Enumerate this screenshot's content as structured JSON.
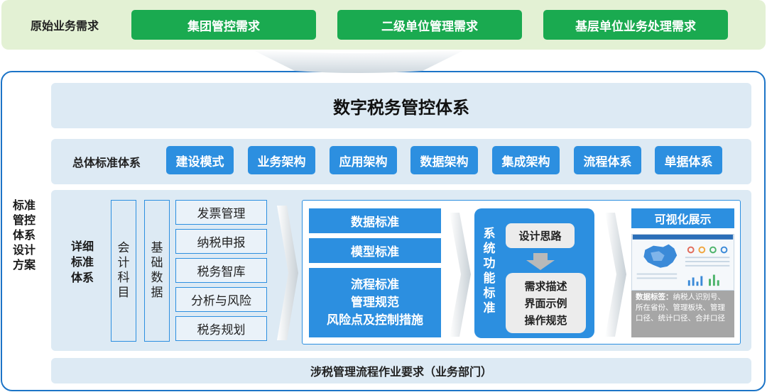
{
  "requirements": {
    "title": "原始业务需求",
    "items": [
      "集团管控需求",
      "二级单位管理需求",
      "基层单位业务处理需求"
    ]
  },
  "frame": {
    "label_lines": [
      "标准",
      "管控",
      "体系",
      "设计",
      "方案"
    ]
  },
  "system_title": "数字税务管控体系",
  "overall": {
    "label": "总体标准体系",
    "items": [
      "建设模式",
      "业务架构",
      "应用架构",
      "数据架构",
      "集成架构",
      "流程体系",
      "单据体系"
    ]
  },
  "detail": {
    "label_lines": [
      "详细",
      "标准",
      "体系"
    ],
    "account_lines": [
      "会",
      "计",
      "科",
      "目"
    ],
    "basedata_lines": [
      "基",
      "础",
      "数",
      "据"
    ],
    "modules": [
      "发票管理",
      "纳税申报",
      "税务智库",
      "分析与风险",
      "税务规划"
    ],
    "standards": {
      "data": "数据标准",
      "model": "模型标准",
      "flow_lines": [
        "流程标准",
        "管理规范",
        "风险点及控制措施"
      ]
    },
    "function": {
      "label_lines": [
        "系",
        "统",
        "功",
        "能",
        "标",
        "准"
      ],
      "design": "设计思路",
      "spec_lines": [
        "需求描述",
        "界面示例",
        "操作规范"
      ]
    },
    "visual": {
      "title": "可视化展示",
      "note_label": "数据标签：",
      "note_text": "纳税人识别号、所在省份、管理板块、管理口径、统计口径、合并口径"
    }
  },
  "bottom": "涉税管理流程作业要求（业务部门）",
  "colors": {
    "green": "#1aaa50",
    "blue": "#2c8fe0",
    "frame": "#1c74c7",
    "panel": "#ddeaf4",
    "band": "#e3f1d4"
  }
}
